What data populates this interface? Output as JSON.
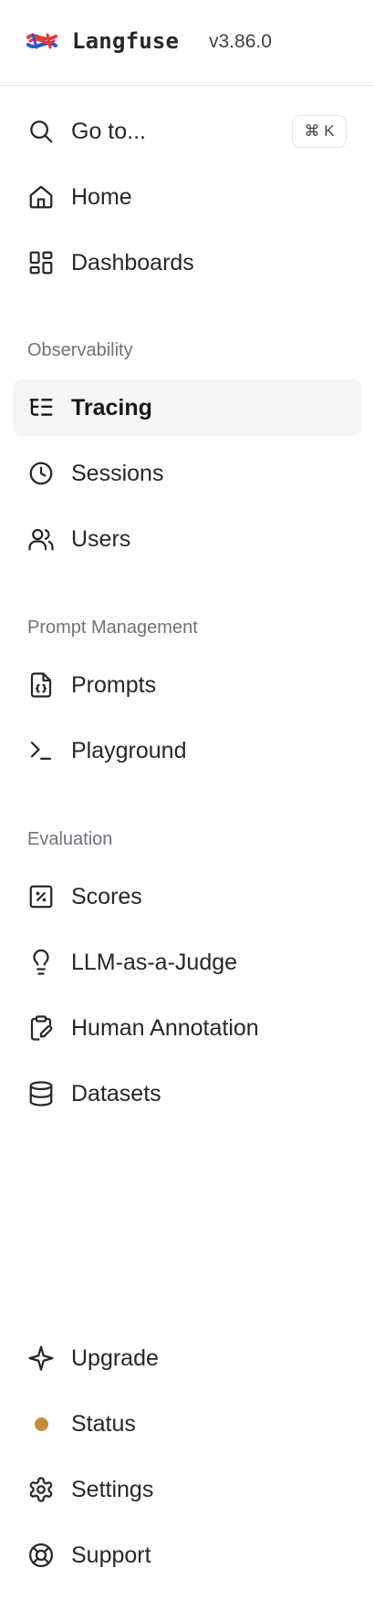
{
  "header": {
    "brand": "Langfuse",
    "version": "v3.86.0",
    "logo_icon": "langfuse-knot-logo"
  },
  "search": {
    "label": "Go to...",
    "shortcut": "⌘ K",
    "icon": "search-icon"
  },
  "nav": {
    "home": {
      "label": "Home",
      "icon": "home-icon"
    },
    "dashboards": {
      "label": "Dashboards",
      "icon": "dashboard-icon"
    }
  },
  "sections": {
    "observability": {
      "title": "Observability",
      "items": {
        "tracing": {
          "label": "Tracing",
          "icon": "list-tree-icon",
          "active": true
        },
        "sessions": {
          "label": "Sessions",
          "icon": "clock-icon"
        },
        "users": {
          "label": "Users",
          "icon": "users-icon"
        }
      }
    },
    "prompt_management": {
      "title": "Prompt Management",
      "items": {
        "prompts": {
          "label": "Prompts",
          "icon": "file-braces-icon"
        },
        "playground": {
          "label": "Playground",
          "icon": "terminal-icon"
        }
      }
    },
    "evaluation": {
      "title": "Evaluation",
      "items": {
        "scores": {
          "label": "Scores",
          "icon": "percent-square-icon"
        },
        "llm_judge": {
          "label": "LLM-as-a-Judge",
          "icon": "lightbulb-icon"
        },
        "human_annotation": {
          "label": "Human Annotation",
          "icon": "clipboard-pen-icon"
        },
        "datasets": {
          "label": "Datasets",
          "icon": "database-icon"
        }
      }
    }
  },
  "footer": {
    "upgrade": {
      "label": "Upgrade",
      "icon": "sparkle-icon"
    },
    "status": {
      "label": "Status",
      "icon": "status-dot-icon"
    },
    "settings": {
      "label": "Settings",
      "icon": "gear-icon"
    },
    "support": {
      "label": "Support",
      "icon": "lifebuoy-icon"
    }
  },
  "colors": {
    "active_bg": "#f4f5f7",
    "status_dot": "#c28e3a",
    "section_title": "#71717a",
    "text": "#27272a",
    "border": "#e4e4e7"
  }
}
